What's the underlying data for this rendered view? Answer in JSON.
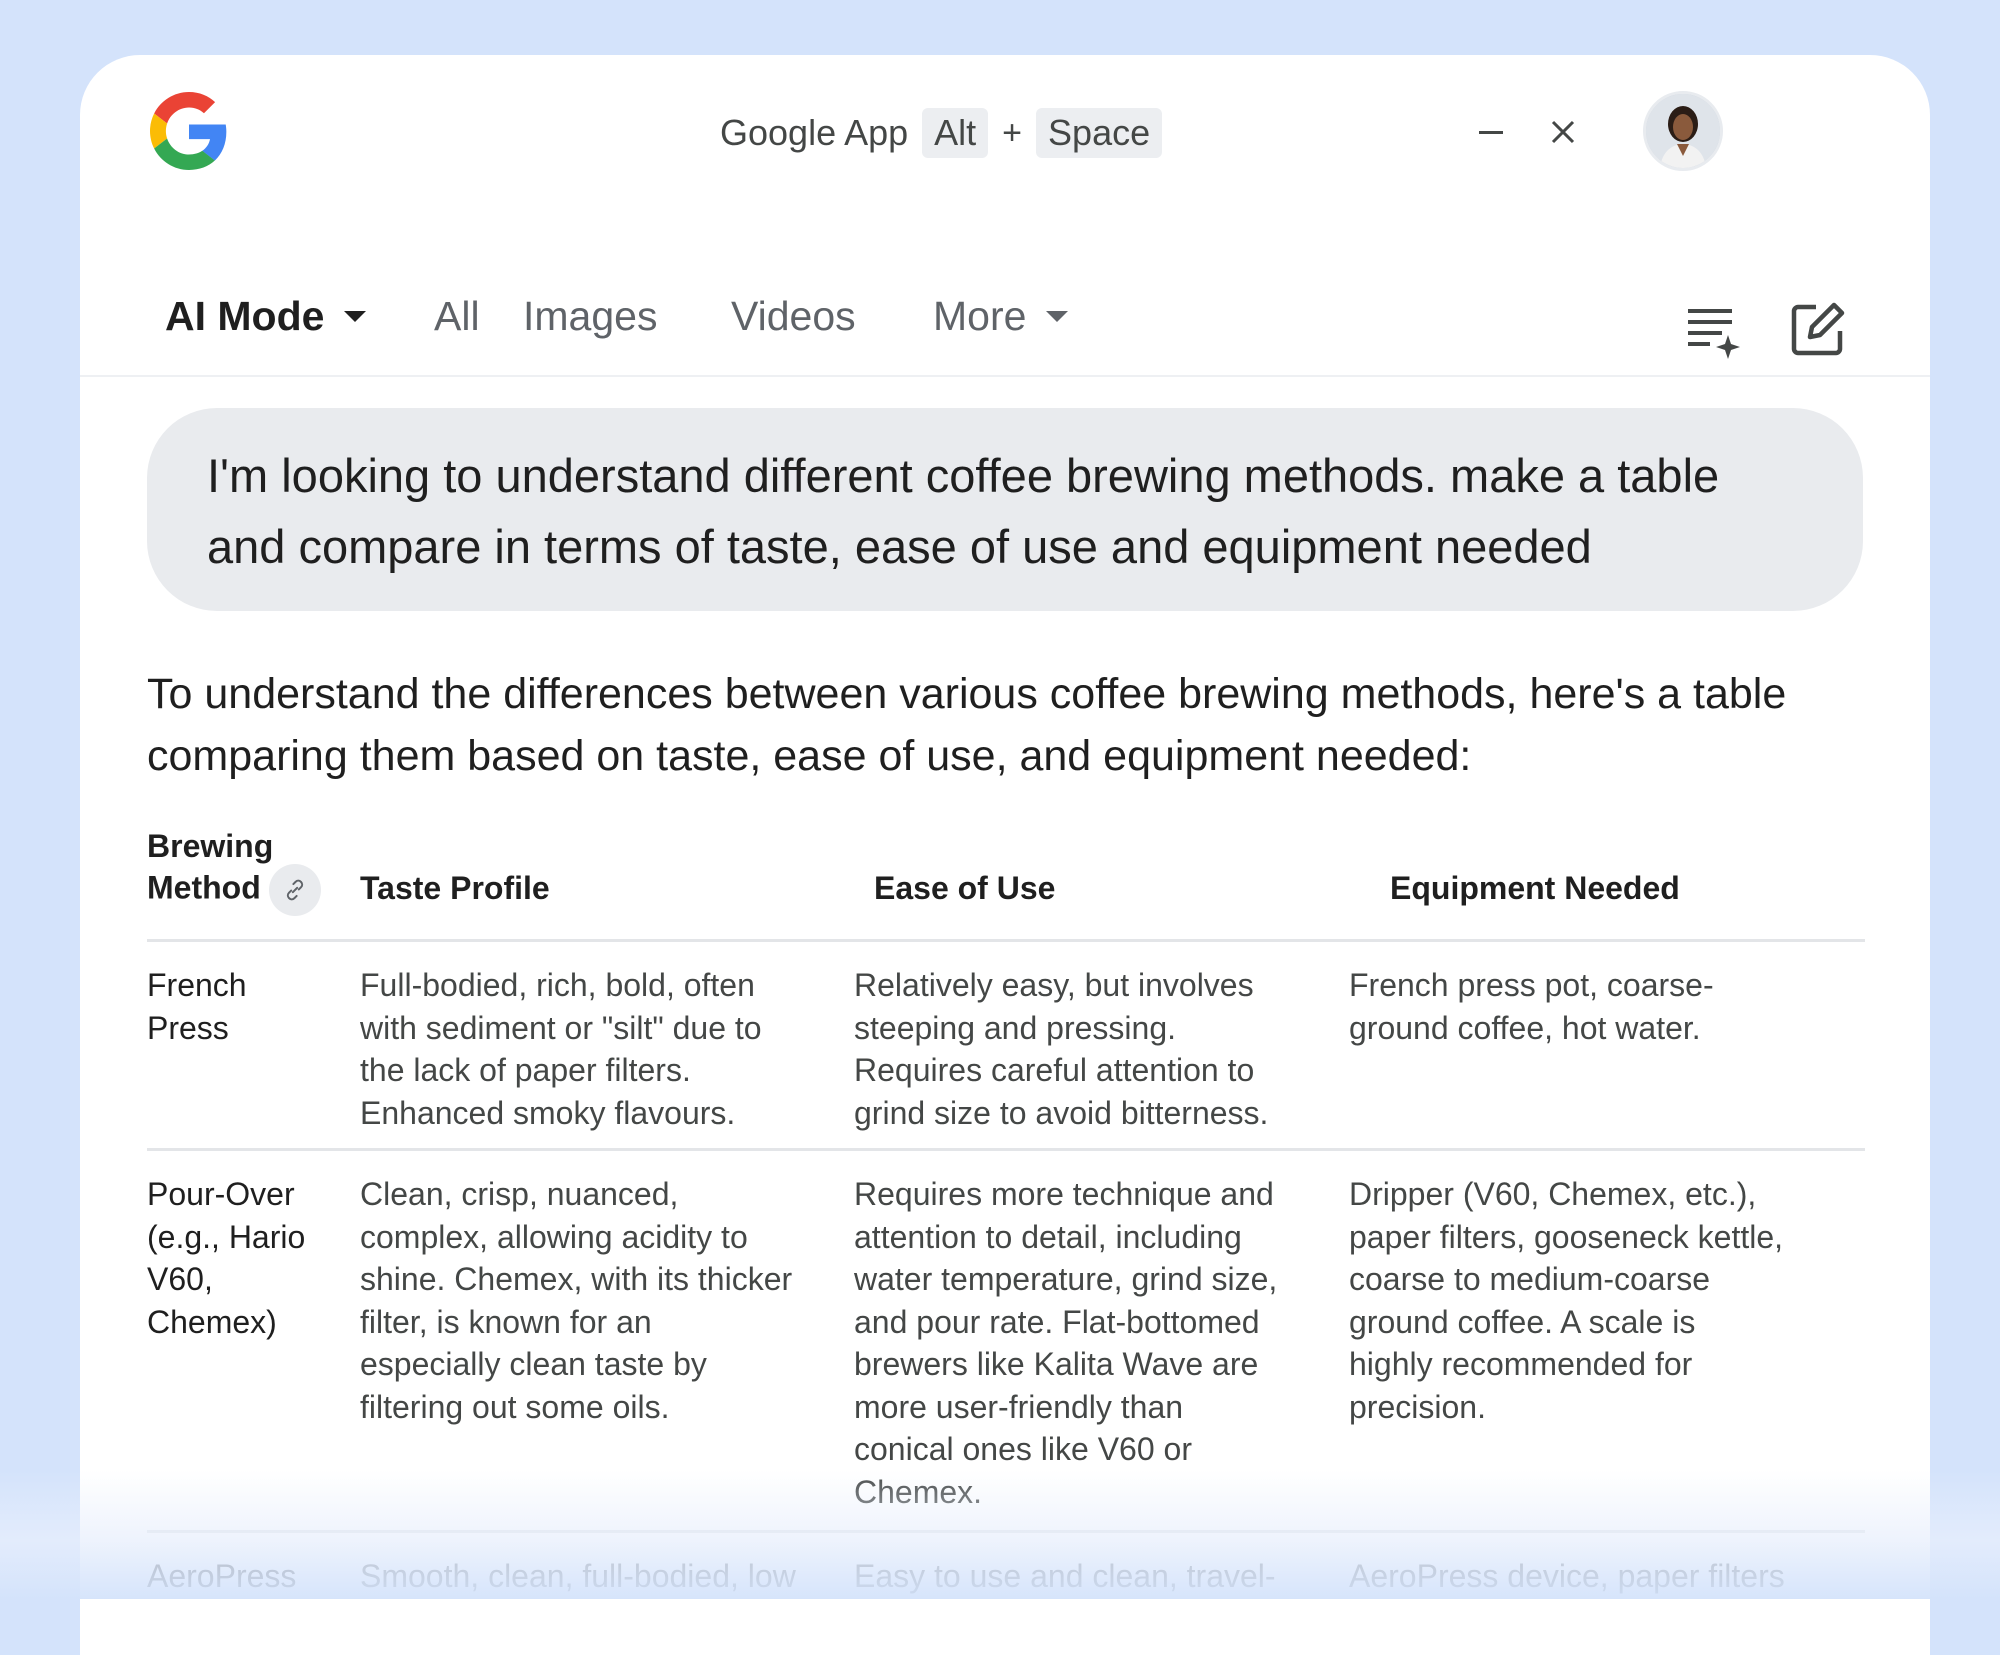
{
  "colors": {
    "background": "#d4e3fb",
    "window": "#ffffff",
    "query_bubble": "#e9ebee",
    "text_primary": "#1f1f1f",
    "text_secondary": "#444746"
  },
  "titlebar": {
    "logo_icon": "google-g-icon",
    "app_name": "Google App",
    "shortcut_key1": "Alt",
    "shortcut_plus": "+",
    "shortcut_key2": "Space",
    "minimize_icon": "minimize-icon",
    "close_icon": "close-icon"
  },
  "tabs": {
    "ai_mode": "AI Mode",
    "all": "All",
    "images": "Images",
    "videos": "Videos",
    "more": "More"
  },
  "toolbar": {
    "history_icon": "history-list-icon",
    "new_chat_icon": "new-chat-edit-icon"
  },
  "query": "I'm looking to understand different coffee brewing methods. make a table and compare in terms of taste, ease of use and equipment needed",
  "intro": "To understand the differences between various coffee brewing methods, here's a table comparing them based on taste, ease of use, and equipment needed:",
  "table": {
    "headers": [
      "Brewing Method",
      "Taste Profile",
      "Ease of Use",
      "Equipment Needed"
    ],
    "header_method_line1": "Brewing",
    "header_method_line2": "Method",
    "rows": [
      {
        "method_lines": [
          "French",
          "Press"
        ],
        "taste_lines": [
          "Full-bodied, rich, bold, often",
          "with sediment or \"silt\" due to",
          "the lack of paper filters.",
          "Enhanced smoky flavours."
        ],
        "ease_lines": [
          "Relatively easy, but involves",
          "steeping and pressing.",
          "Requires careful attention to",
          "grind size to avoid bitterness."
        ],
        "equip_lines": [
          "French press pot, coarse-",
          "ground coffee, hot water."
        ]
      },
      {
        "method_lines": [
          "Pour-Over",
          "(e.g., Hario",
          "V60,",
          "Chemex)"
        ],
        "taste_lines": [
          "Clean, crisp, nuanced,",
          "complex, allowing acidity to",
          "shine. Chemex, with its thicker",
          "filter, is known for an",
          "especially clean taste by",
          "filtering out some oils."
        ],
        "ease_lines": [
          "Requires more technique and",
          "attention to detail, including",
          "water temperature, grind size,",
          "and pour rate. Flat-bottomed",
          "brewers like Kalita Wave are",
          "more user-friendly than",
          "conical ones like V60 or",
          "Chemex."
        ],
        "equip_lines": [
          "Dripper (V60, Chemex, etc.),",
          "paper filters, gooseneck kettle,",
          "coarse to medium-coarse",
          "ground coffee. A scale is",
          "highly recommended for",
          "precision."
        ]
      },
      {
        "method_lines": [
          "AeroPress"
        ],
        "taste_lines": [
          "Smooth, clean, full-bodied, low"
        ],
        "ease_lines": [
          "Easy to use and clean, travel-"
        ],
        "equip_lines": [
          "AeroPress device, paper filters"
        ]
      }
    ]
  }
}
